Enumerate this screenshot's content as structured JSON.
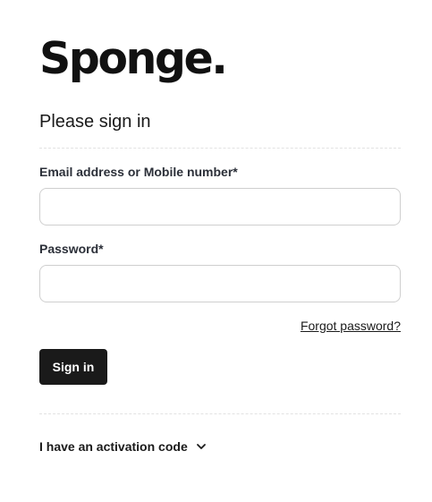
{
  "brand": {
    "logo_text": "Sponge."
  },
  "form": {
    "heading": "Please sign in",
    "email": {
      "label": "Email address or Mobile number*",
      "value": "",
      "placeholder": ""
    },
    "password": {
      "label": "Password*",
      "value": "",
      "placeholder": ""
    },
    "forgot_password_label": "Forgot password?",
    "sign_in_label": "Sign in"
  },
  "activation": {
    "label": "I have an activation code",
    "icon": "chevron-down-icon"
  },
  "colors": {
    "button_bg": "#1a1a1a",
    "button_text": "#ffffff",
    "text": "#1a1a1a",
    "border": "#cfcfcf",
    "divider": "#e2e2e2"
  }
}
